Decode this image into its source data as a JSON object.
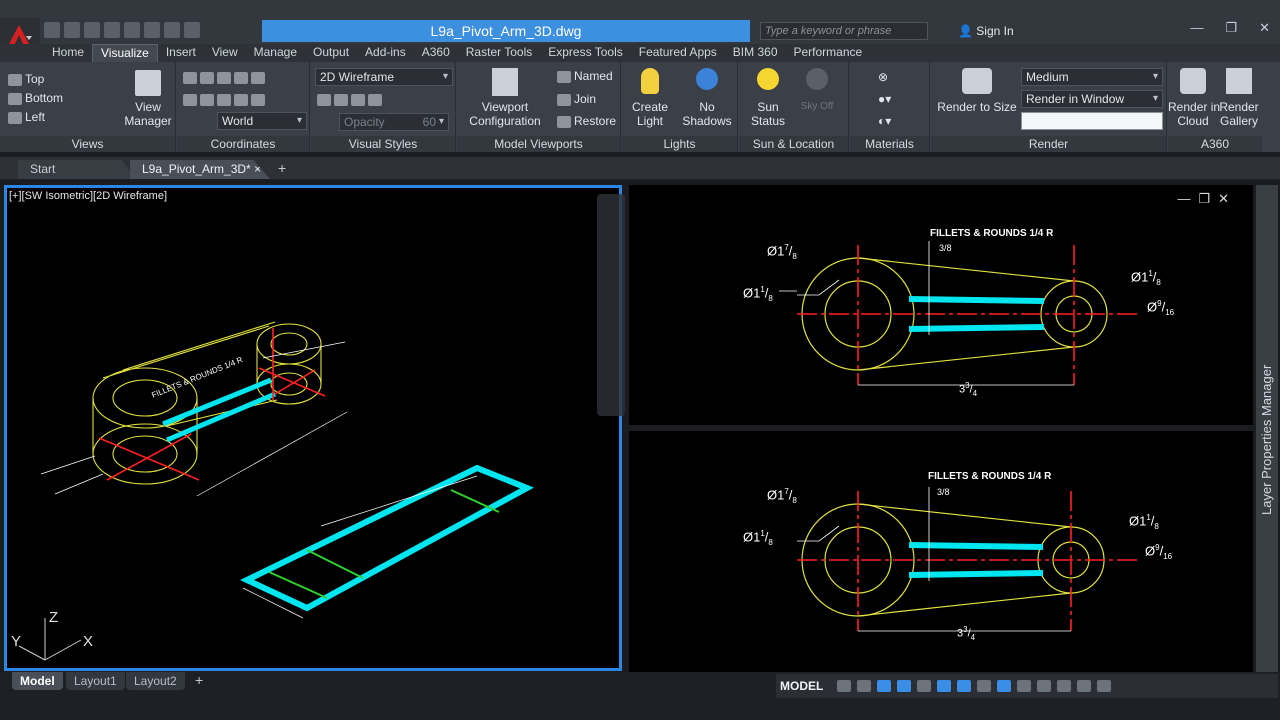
{
  "title": {
    "doc": "L9a_Pivot_Arm_3D.dwg",
    "search_placeholder": "Type a keyword or phrase",
    "signin": "Sign In"
  },
  "tabs": [
    "Home",
    "Visualize",
    "Insert",
    "View",
    "Manage",
    "Output",
    "Add-ins",
    "A360",
    "Raster Tools",
    "Express Tools",
    "Featured Apps",
    "BIM 360",
    "Performance"
  ],
  "views": {
    "items": [
      "Top",
      "Bottom",
      "Left"
    ],
    "view_manager": "View\nManager",
    "title": "Views"
  },
  "coords": {
    "world": "World",
    "title": "Coordinates"
  },
  "visual": {
    "style": "2D Wireframe",
    "opacity_label": "Opacity",
    "opacity_value": "60",
    "title": "Visual Styles"
  },
  "viewports": {
    "config": "Viewport\nConfiguration",
    "named": "Named",
    "join": "Join",
    "restore": "Restore",
    "title": "Model Viewports"
  },
  "lights": {
    "create": "Create\nLight",
    "shadows": "No\nShadows",
    "title": "Lights"
  },
  "sun": {
    "status": "Sun\nStatus",
    "sky": "Sky Off",
    "title": "Sun & Location"
  },
  "materials": {
    "title": "Materials"
  },
  "render": {
    "size": "Render to Size",
    "quality": "Medium",
    "window": "Render in Window",
    "title": "Render"
  },
  "a360": {
    "cloud": "Render in\nCloud",
    "gallery": "Render\nGallery",
    "title": "A360"
  },
  "filetabs": [
    "Start",
    "L9a_Pivot_Arm_3D*"
  ],
  "vp_label": "[+][SW Isometric][2D Wireframe]",
  "drawing": {
    "note": "FILLETS & ROUNDS 1/4 R",
    "d1": "Ø1",
    "d1_num": "7",
    "d1_den": "8",
    "d2": "Ø1",
    "d2_num": "1",
    "d2_den": "8",
    "d3": "Ø1",
    "d3_num": "1",
    "d3_den": "8",
    "d4": "Ø",
    "d4_num": "9",
    "d4_den": "16",
    "len": "3",
    "len_num": "3",
    "len_den": "4",
    "web_num": "3",
    "web_den": "8"
  },
  "ucs": {
    "z": "Z",
    "y": "Y",
    "x": "X"
  },
  "sidebar": "Layer Properties Manager",
  "layouts": [
    "Model",
    "Layout1",
    "Layout2"
  ],
  "status_model": "MODEL",
  "colors": {
    "accent": "#2c86e6",
    "cyan": "#00e6f0",
    "yellow": "#e0e040",
    "red": "#ff2020",
    "green": "#30d030"
  }
}
